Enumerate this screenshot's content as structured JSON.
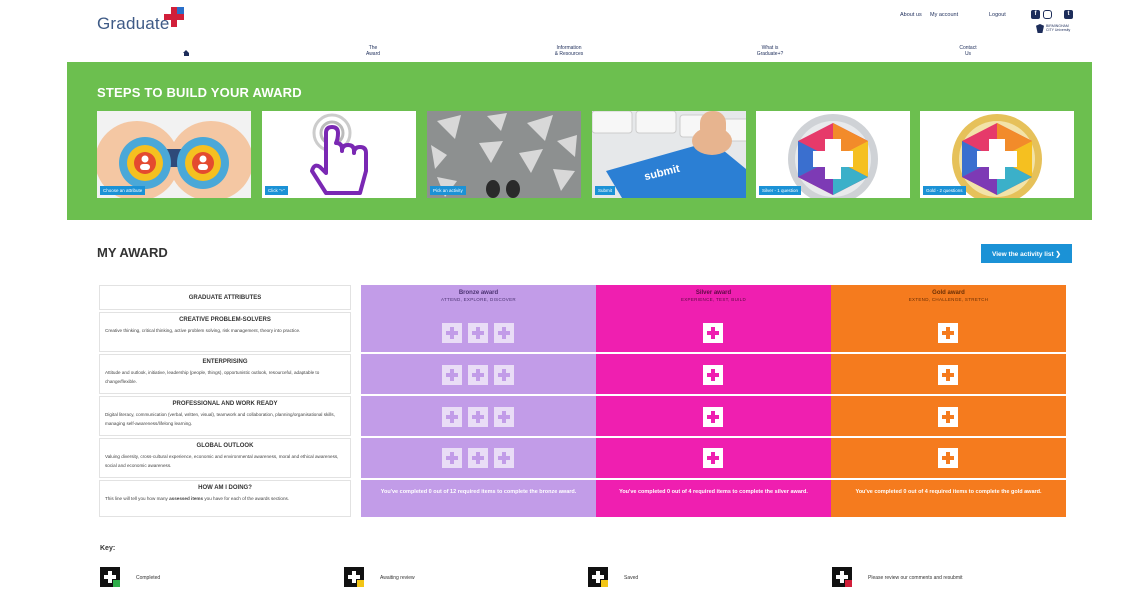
{
  "header": {
    "logo_text": "Graduate",
    "links": [
      "About us",
      "My account",
      "Logout"
    ],
    "social_icons": [
      "facebook-icon",
      "instagram-icon",
      "twitter-icon"
    ],
    "university": "BIRMINGHAM CITY University"
  },
  "nav": {
    "items": [
      {
        "line1": "The",
        "line2": "Award"
      },
      {
        "line1": "Information",
        "line2": "& Resources"
      },
      {
        "line1": "What is",
        "line2": "Graduate+?"
      },
      {
        "line1": "Contact",
        "line2": "Us"
      }
    ]
  },
  "steps": {
    "title": "STEPS TO BUILD YOUR AWARD",
    "cards": [
      {
        "label": "Choose an attribute"
      },
      {
        "label": "Click \"+\""
      },
      {
        "label": "Pick an activity"
      },
      {
        "label": "Submit"
      },
      {
        "label": "Silver - 1 question"
      },
      {
        "label": "Gold - 2 questions"
      }
    ],
    "submit_key_text": "submit"
  },
  "award": {
    "title": "MY AWARD",
    "activity_button": "View the activity list ❯",
    "attr_header": "GRADUATE ATTRIBUTES",
    "levels": [
      {
        "name": "Bronze award",
        "sub": "ATTEND, EXPLORE, DISCOVER"
      },
      {
        "name": "Silver award",
        "sub": "EXPERIENCE, TEST, BUILD"
      },
      {
        "name": "Gold award",
        "sub": "EXTEND, CHALLENGE, STRETCH"
      }
    ],
    "attributes": [
      {
        "title": "CREATIVE PROBLEM-SOLVERS",
        "desc": "Creative thinking, critical thinking, active problem solving, risk management, theory into practice."
      },
      {
        "title": "ENTERPRISING",
        "desc": "Attitude and outlook, initiative, leadership (people, things), opportunistic outlook, resourceful, adaptable to change/flexible."
      },
      {
        "title": "PROFESSIONAL AND WORK READY",
        "desc": "Digital literacy, communication (verbal, written, visual), teamwork and collaboration, planning/organisational skills, managing self-awareness/lifelong learning."
      },
      {
        "title": "GLOBAL OUTLOOK",
        "desc": "Valuing diversity, cross-cultural experience, economic and environmental awareness, moral and ethical awareness, social and economic awareness."
      }
    ],
    "progress": {
      "title": "HOW AM I DOING?",
      "desc_prefix": "This line will tell you how many ",
      "desc_bold": "assessed items",
      "desc_suffix": " you have for each of the awards sections.",
      "bronze": "You've completed 0 out of 12 required items to complete the bronze award.",
      "silver": "You've completed 0 out of 4 required items to complete the silver award.",
      "gold": "You've completed 0 out of 4 required items to complete the gold award."
    }
  },
  "key": {
    "title": "Key:",
    "items": [
      {
        "label": "Completed",
        "badge_color": "#2fae4a"
      },
      {
        "label": "Awaiting review",
        "badge_color": "#f2c516"
      },
      {
        "label": "Saved",
        "badge_color": "#f2c516"
      },
      {
        "label": "Please review our comments and resubmit",
        "badge_color": "#d11f3a"
      }
    ]
  }
}
